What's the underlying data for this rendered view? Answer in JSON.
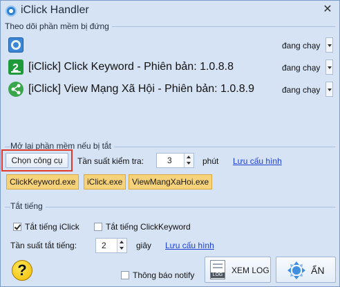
{
  "window": {
    "title": "iClick Handler",
    "close_symbol": "✕"
  },
  "monitor": {
    "group_label": "Theo dõi phần mềm bị đứng",
    "rows": [
      {
        "icon": "iclick-icon",
        "label": "",
        "status": "đang chạy"
      },
      {
        "icon": "click-keyword-icon",
        "label": "[iClick] Click Keyword - Phiên bản: 1.0.8.8",
        "status": "đang chạy"
      },
      {
        "icon": "share-icon",
        "label": "[iClick] View Mạng Xã Hội - Phiên bản: 1.0.8.9",
        "status": "đang chạy"
      }
    ]
  },
  "restart": {
    "group_label": "Mở lại phần mềm nếu bị tắt",
    "choose_button": "Chọn công cụ",
    "freq_label": "Tần suất kiểm tra:",
    "freq_value": "3",
    "freq_unit": "phút",
    "save_link": "Lưu cấu hình",
    "tools": [
      "ClickKeyword.exe",
      "iClick.exe",
      "ViewMangXaHoi.exe"
    ]
  },
  "mute": {
    "group_label": "Tắt tiếng",
    "mute_iclick": {
      "label": "Tắt tiếng iClick",
      "checked": true
    },
    "mute_clickkeyword": {
      "label": "Tắt tiếng ClickKeyword",
      "checked": false
    },
    "freq_label": "Tần suất tắt tiếng:",
    "freq_value": "2",
    "freq_unit": "giây",
    "save_link": "Lưu cấu hình"
  },
  "footer": {
    "help_symbol": "?",
    "notify": {
      "label": "Thông báo notify",
      "checked": false
    },
    "view_log_button": "XEM LOG",
    "log_icon_text": "LOG",
    "hide_button": "ẨN"
  },
  "colors": {
    "background": "#d6e3f5",
    "highlight_border": "#e0382b",
    "chip": "#f6d27a",
    "link": "#1c3fd0"
  }
}
